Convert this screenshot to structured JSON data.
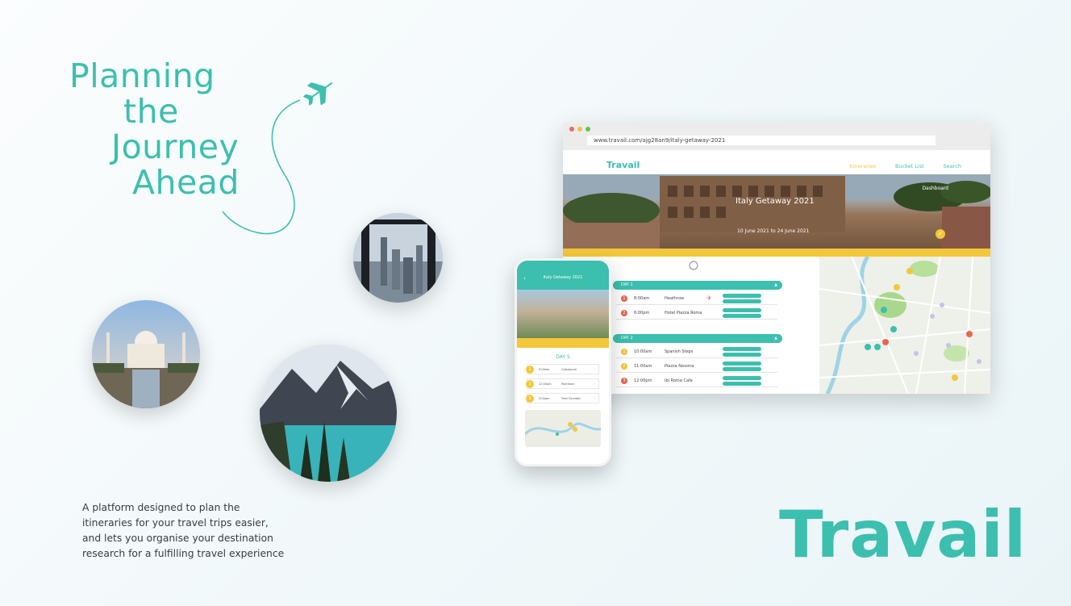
{
  "headline": [
    "Planning",
    "the",
    "Journey",
    "Ahead"
  ],
  "description": [
    "A platform designed to plan the",
    "itineraries for your travel trips easier,",
    "and lets you organise your destination",
    "research for a fulfilling travel experience"
  ],
  "brand": "Travail",
  "colors": {
    "accent": "#3cbfae",
    "highlight": "#f2c73a",
    "alert": "#e9674f"
  },
  "browser": {
    "url": "www.travail.com/ajg28an9/italy-getaway-2021",
    "logo": "Travail",
    "nav": [
      "Itineraries",
      "Bucket List",
      "Search"
    ],
    "trip_title": "Italy Getaway 2021",
    "trip_dates": "10 June 2021 to 24 June 2021",
    "dashboard": "Dashboard",
    "days": [
      {
        "label": "DAY 1",
        "rows": [
          {
            "num": "1",
            "time": "8:00am",
            "place": "Heathrow"
          },
          {
            "num": "2",
            "time": "6:00pm",
            "place": "Hotel Piazza Roma"
          }
        ]
      },
      {
        "label": "DAY 2",
        "rows": [
          {
            "num": "1",
            "time": "10:00am",
            "place": "Spanish Steps"
          },
          {
            "num": "2",
            "time": "11:00am",
            "place": "Piazza Navona"
          },
          {
            "num": "3",
            "time": "12:00pm",
            "place": "Ibi Roma Cafe"
          }
        ]
      }
    ]
  },
  "phone": {
    "title": "Italy Getaway 2021",
    "day": "DAY 5",
    "rows": [
      {
        "num": "1",
        "time": "9:00am",
        "place": "Colosseum"
      },
      {
        "num": "2",
        "time": "12:00pm",
        "place": "Pantheon"
      },
      {
        "num": "3",
        "time": "3:00pm",
        "place": "Trevi Fountain"
      }
    ]
  },
  "icons": [
    "airplane-icon",
    "check-icon",
    "chevron-down-icon",
    "back-arrow-icon"
  ]
}
